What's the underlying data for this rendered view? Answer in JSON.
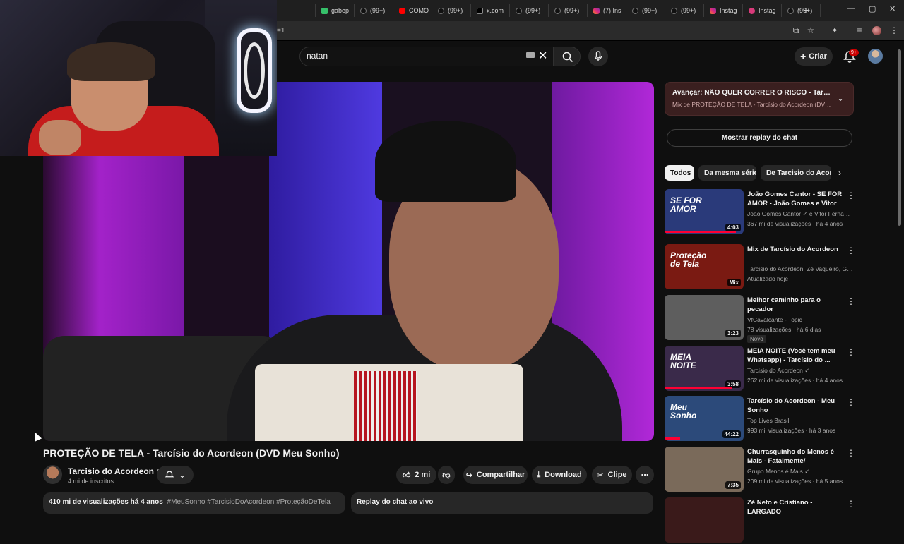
{
  "browser": {
    "tabs": [
      {
        "label": "",
        "icon": "tab-icon"
      },
      {
        "label": "gabep",
        "icon": "green"
      },
      {
        "label": "(99+)",
        "icon": "tiktok"
      },
      {
        "label": "COMO",
        "icon": "yt"
      },
      {
        "label": "(99+)",
        "icon": "tiktok"
      },
      {
        "label": "x.com",
        "icon": "x"
      },
      {
        "label": "(99+)",
        "icon": "tiktok"
      },
      {
        "label": "(99+)",
        "icon": "tiktok"
      },
      {
        "label": "(7) Ins",
        "icon": "ig"
      },
      {
        "label": "(99+)",
        "icon": "tiktok"
      },
      {
        "label": "(99+)",
        "icon": "tiktok"
      },
      {
        "label": "Instag",
        "icon": "ig"
      },
      {
        "label": "Instag",
        "icon": "ph"
      },
      {
        "label": "(99+)",
        "icon": "tiktok"
      }
    ],
    "new_tab": "+",
    "url_fragment": "=1"
  },
  "youtube": {
    "search_query": "natan",
    "create_label": "Criar",
    "notifications_badge": "9+"
  },
  "video": {
    "title": "PROTEÇÃO DE TELA - Tarcísio do Acordeon (DVD Meu Sonho)",
    "channel": "Tarcisio do Acordeon",
    "subscribers": "4 mi de inscritos",
    "likes": "2 mi",
    "share_label": "Compartilhar",
    "download_label": "Download",
    "clip_label": "Clipe",
    "views": "410 mi de visualizações",
    "age": "há 4 anos",
    "tags": "#MeuSonho #TarcisioDoAcordeon #ProteçãoDeTela",
    "chat_replay_label": "Replay do chat ao vivo"
  },
  "sidebar": {
    "next_title": "Avançar: NÃO QUER CORRER O RISCO - Tarcísio do...",
    "next_sub": "Mix de PROTEÇÃO DE TELA - Tarcísio do Acordeon (DVD Me...",
    "chat_button": "Mostrar replay do chat",
    "chips": [
      "Todos",
      "Da mesma série",
      "De Tarcisio do Acordeon"
    ],
    "recommendations": [
      {
        "title": "João Gomes Cantor - SE FOR AMOR - João Gomes e Vitor ...",
        "channel": "João Gomes Cantor ✓ e Vitor Fernande...",
        "meta": "367 mi de visualizações · há 4 anos",
        "duration": "4:03",
        "badge": "",
        "thumb_text": "SE FOR AMOR",
        "thumb_bg": "#2a3a7a",
        "progress": 0.9
      },
      {
        "title": "Mix de Tarcísio do Acordeon",
        "channel": "Tarcísio do Acordeon, Zé Vaqueiro, Grup...",
        "meta": "Atualizado hoje",
        "duration": "Mix",
        "badge": "",
        "thumb_text": "Proteção de Tela",
        "thumb_bg": "#7a1a12",
        "progress": 0
      },
      {
        "title": "Melhor caminho para o pecador",
        "channel": "VfCavalcante - Topic",
        "meta": "78 visualizações · há 6 dias",
        "duration": "3:23",
        "badge": "Novo",
        "thumb_text": "",
        "thumb_bg": "#5e5e5e",
        "progress": 0
      },
      {
        "title": "MEIA NOITE (Você tem meu Whatsapp) - Tarcísio do ...",
        "channel": "Tarcisio do Acordeon ✓",
        "meta": "262 mi de visualizações · há 4 anos",
        "duration": "3:58",
        "badge": "",
        "thumb_text": "MEIA NOITE",
        "thumb_bg": "#3a2a4a",
        "progress": 0.85
      },
      {
        "title": "Tarcísio do Acordeon - Meu Sonho",
        "channel": "Top Lives Brasil",
        "meta": "993 mil visualizações · há 3 anos",
        "duration": "44:22",
        "badge": "",
        "thumb_text": "Meu Sonho",
        "thumb_bg": "#2c4a7a",
        "progress": 0.2
      },
      {
        "title": "Churrasquinho do Menos é Mais - Fatalmente/ Separação...",
        "channel": "Grupo Menos é Mais ✓",
        "meta": "209 mi de visualizações · há 5 anos",
        "duration": "7:35",
        "badge": "",
        "thumb_text": "",
        "thumb_bg": "#7a6a5a",
        "progress": 0
      },
      {
        "title": "Zé Neto e Cristiano - LARGADO",
        "channel": "",
        "meta": "",
        "duration": "",
        "badge": "",
        "thumb_text": "",
        "thumb_bg": "#3a1a1a",
        "progress": 0
      }
    ]
  }
}
